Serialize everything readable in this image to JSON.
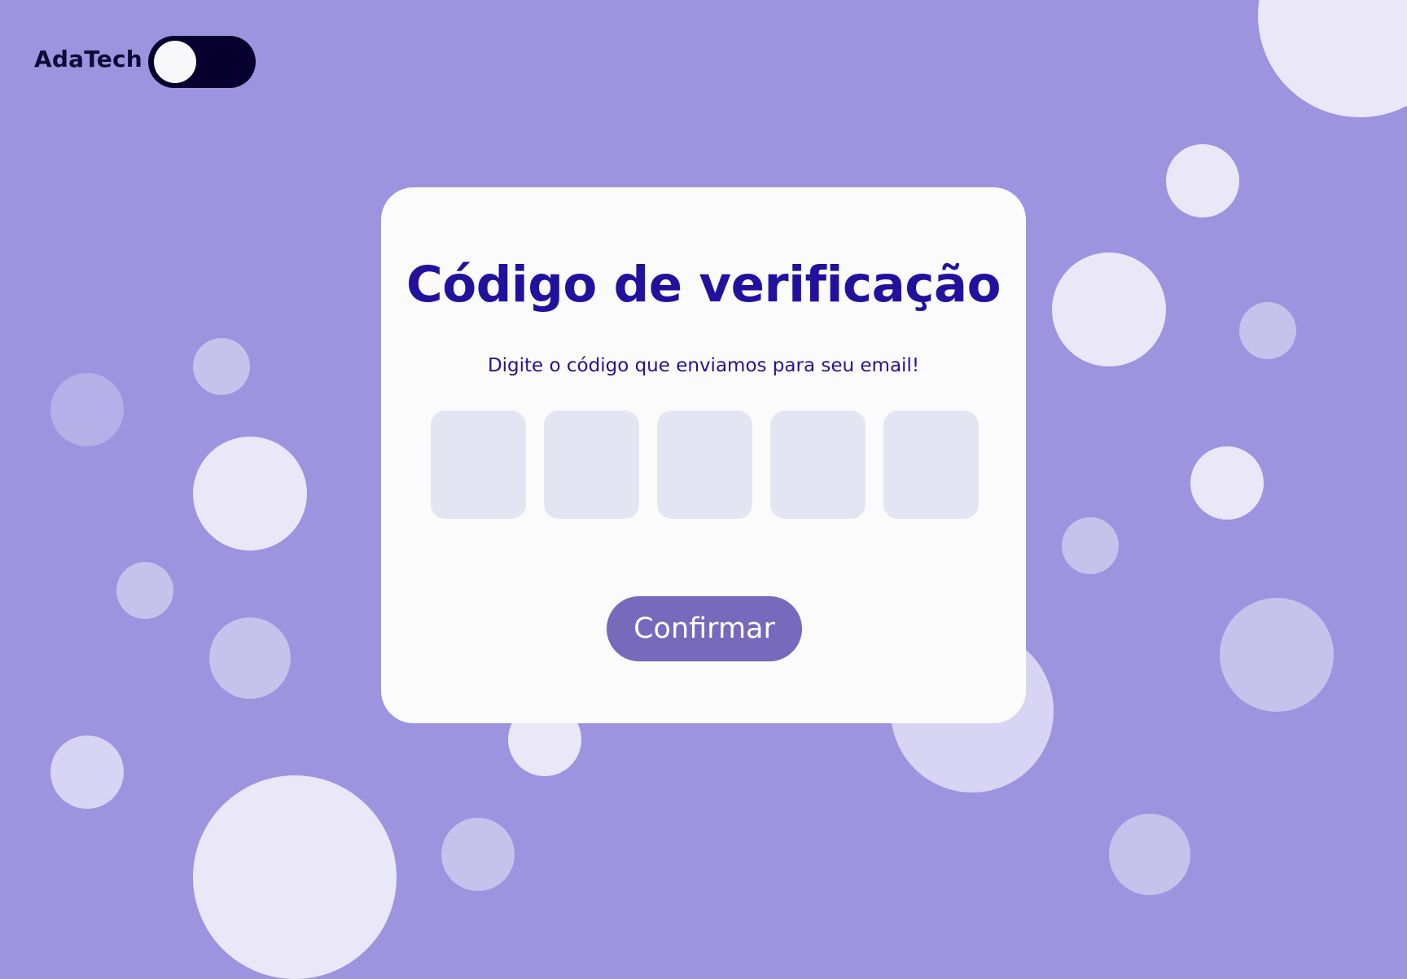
{
  "header": {
    "brand": "AdaTech",
    "theme_toggle": {
      "state": "off"
    }
  },
  "verification": {
    "title": "Código de verificação",
    "subtitle": "Digite o código que enviamos para seu email!",
    "code_fields": [
      {
        "value": ""
      },
      {
        "value": ""
      },
      {
        "value": ""
      },
      {
        "value": ""
      },
      {
        "value": ""
      }
    ],
    "confirm_label": "Confirmar"
  },
  "colors": {
    "background": "#9d94e0",
    "card": "#fbfbfc",
    "title": "#22119c",
    "button": "#7769bb",
    "toggle": "#07002e",
    "code_field": "#e3e5f2"
  }
}
